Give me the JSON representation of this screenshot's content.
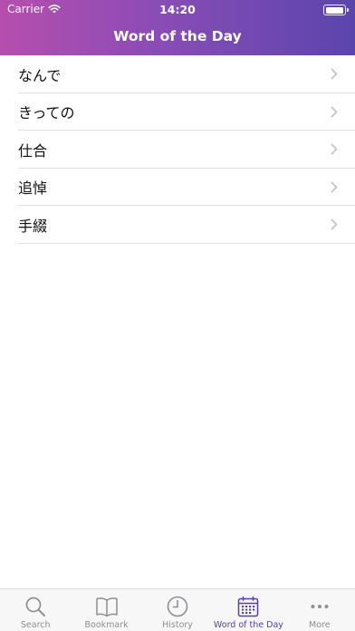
{
  "status_bar": {
    "carrier": "Carrier",
    "time": "14:20"
  },
  "nav": {
    "title": "Word of the Day"
  },
  "words": [
    {
      "label": "なんで"
    },
    {
      "label": "きっての"
    },
    {
      "label": "仕合"
    },
    {
      "label": "追悼"
    },
    {
      "label": "手綴"
    }
  ],
  "tabs": [
    {
      "label": "Search",
      "icon": "search-icon"
    },
    {
      "label": "Bookmark",
      "icon": "book-icon"
    },
    {
      "label": "History",
      "icon": "clock-icon"
    },
    {
      "label": "Word of the Day",
      "icon": "calendar-icon",
      "active": true
    },
    {
      "label": "More",
      "icon": "more-icon"
    }
  ],
  "colors": {
    "accent": "#5b3fa8",
    "header_start": "#b64eae",
    "header_end": "#5a45ad",
    "inactive": "#8e8e93"
  }
}
